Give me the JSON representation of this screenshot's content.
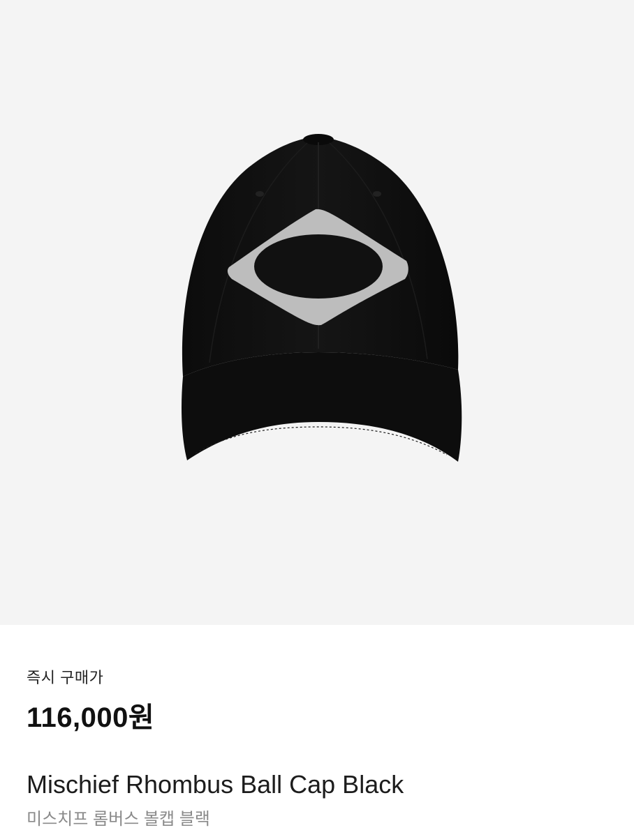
{
  "product": {
    "image_alt": "Mischief Rhombus Ball Cap Black",
    "image_background": "#f4f4f4",
    "cap_color": "#111111",
    "logo_color": "#bdbdbd",
    "price_label": "즉시 구매가",
    "price": "116,000원",
    "name_en": "Mischief Rhombus Ball Cap Black",
    "name_ko": "미스치프 롬버스 볼캡 블랙"
  }
}
